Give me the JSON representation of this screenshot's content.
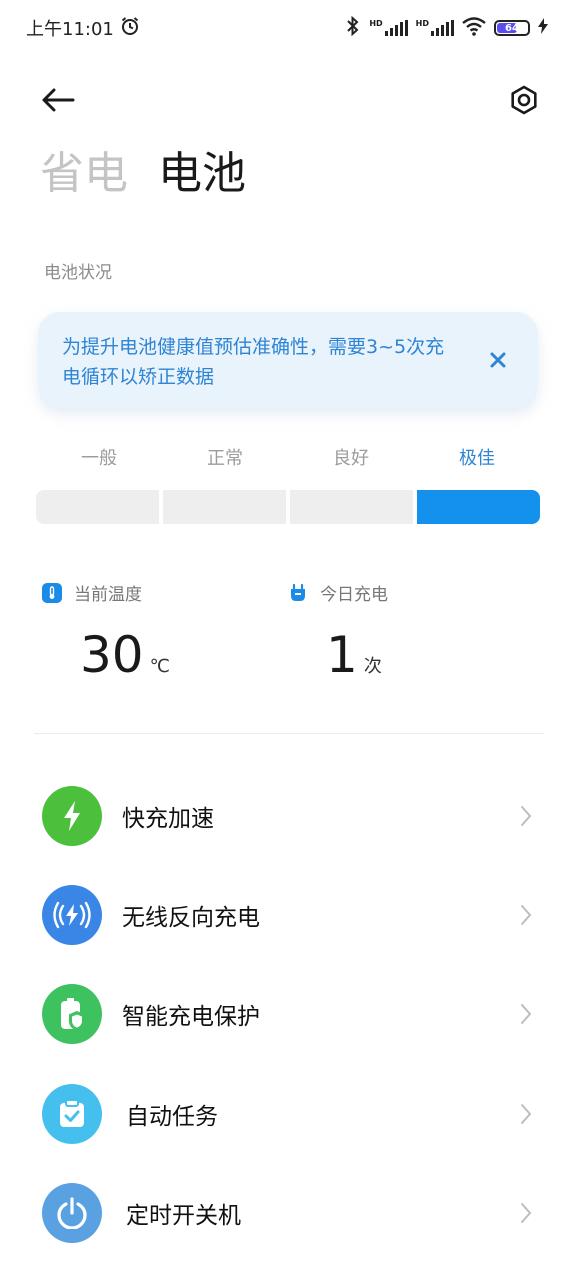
{
  "status_bar": {
    "time": "上午11:01",
    "hd1": "HD",
    "hd2": "HD",
    "battery_level": "64"
  },
  "header": {
    "tabs": [
      {
        "label": "省电",
        "active": false
      },
      {
        "label": "电池",
        "active": true
      }
    ]
  },
  "battery_status": {
    "section_title": "电池状况",
    "notice": "为提升电池健康值预估准确性，需要3~5次充电循环以矫正数据",
    "levels": [
      "一般",
      "正常",
      "良好",
      "极佳"
    ],
    "selected_level": "极佳"
  },
  "stats": {
    "temperature": {
      "label": "当前温度",
      "value": "30",
      "unit": "℃"
    },
    "charge_today": {
      "label": "今日充电",
      "value": "1",
      "unit": "次"
    }
  },
  "menu": {
    "items": [
      {
        "label": "快充加速",
        "icon": "lightning-icon",
        "color": "#4cbf3c"
      },
      {
        "label": "无线反向充电",
        "icon": "wireless-charging-icon",
        "color": "#3a86e6"
      },
      {
        "label": "智能充电保护",
        "icon": "battery-shield-icon",
        "color": "#3ec260"
      },
      {
        "label": "自动任务",
        "icon": "clipboard-check-icon",
        "color": "#45c0ee"
      },
      {
        "label": "定时开关机",
        "icon": "power-icon",
        "color": "#5aa1e2"
      }
    ]
  },
  "colors": {
    "accent": "#1391ec",
    "notice_bg": "#e8f3fc",
    "notice_text": "#2f84d4"
  }
}
